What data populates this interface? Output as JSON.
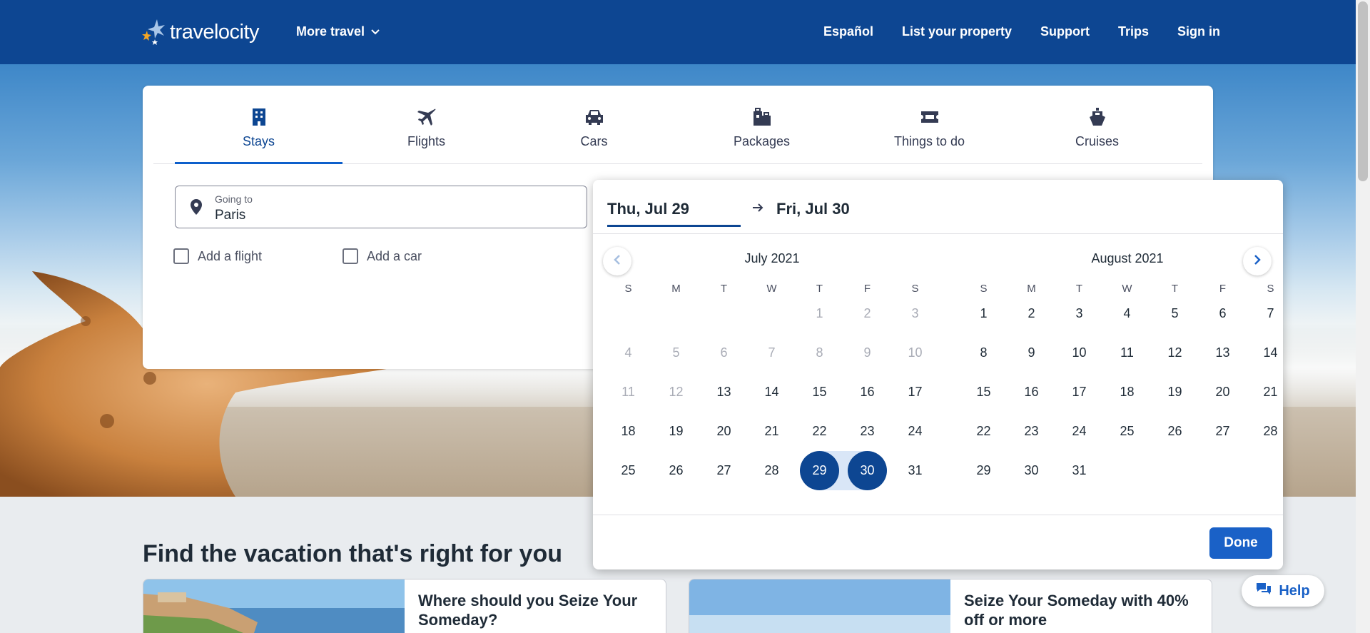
{
  "header": {
    "logo_text": "travelocity",
    "more_travel": "More travel",
    "links": [
      "Español",
      "List your property",
      "Support",
      "Trips",
      "Sign in"
    ]
  },
  "search": {
    "tabs": [
      {
        "label": "Stays",
        "icon": "building-icon",
        "active": true
      },
      {
        "label": "Flights",
        "icon": "plane-icon"
      },
      {
        "label": "Cars",
        "icon": "car-icon"
      },
      {
        "label": "Packages",
        "icon": "luggage-icon"
      },
      {
        "label": "Things to do",
        "icon": "ticket-icon"
      },
      {
        "label": "Cruises",
        "icon": "ship-icon"
      }
    ],
    "going_to": {
      "label": "Going to",
      "value": "Paris"
    },
    "add_flight": "Add a flight",
    "add_car": "Add a car"
  },
  "calendar": {
    "check_in": "Thu, Jul 29",
    "check_out": "Fri, Jul 30",
    "weekdays": [
      "S",
      "M",
      "T",
      "W",
      "T",
      "F",
      "S"
    ],
    "months": [
      {
        "title": "July 2021",
        "first_weekday": 4,
        "days": 31,
        "disabled_through": 12
      },
      {
        "title": "August 2021",
        "first_weekday": 0,
        "days": 31,
        "disabled_through": 0
      }
    ],
    "selected": [
      29,
      30
    ],
    "done": "Done"
  },
  "content": {
    "heading": "Find the vacation that's right for you",
    "promos": [
      "Where should you Seize Your Someday?",
      "Seize Your Someday with 40% off or more"
    ]
  },
  "help": "Help",
  "colors": {
    "brand": "#0d4692",
    "accent": "#1a61c7",
    "logo_star": "#f5a623"
  }
}
